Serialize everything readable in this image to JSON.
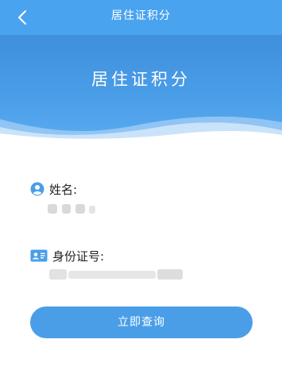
{
  "header": {
    "title": "居住证积分"
  },
  "banner": {
    "title": "居住证积分"
  },
  "form": {
    "name_label": "姓名:",
    "id_label": "身份证号:"
  },
  "query_button": {
    "label": "立即查询"
  },
  "icons": {
    "back": "chevron-left-icon",
    "name": "user-circle-icon",
    "id": "id-card-icon"
  },
  "colors": {
    "primary": "#4aa3ef",
    "button": "#4a9ee8"
  }
}
